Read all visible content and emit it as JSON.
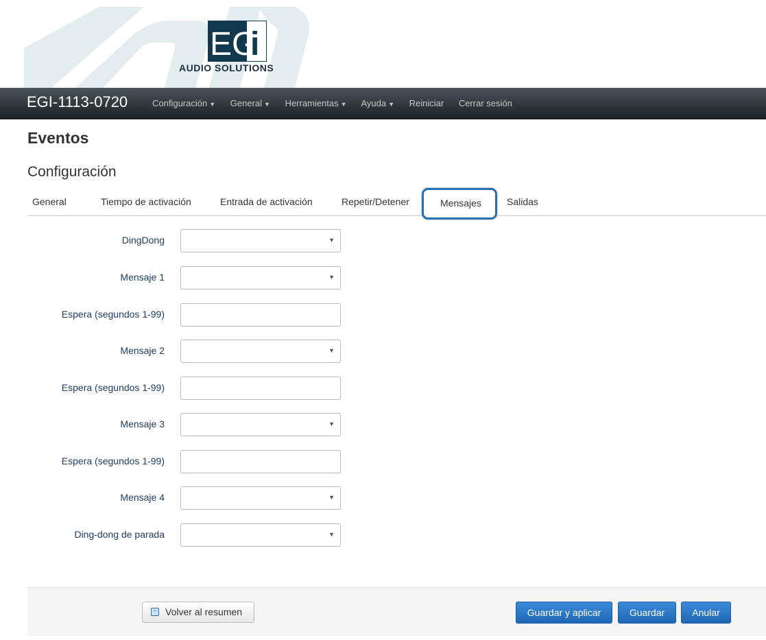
{
  "logo": {
    "letters_left": "EG",
    "letters_right": "i",
    "subtitle": "AUDIO SOLUTIONS"
  },
  "navbar": {
    "brand": "EGI-1113-0720",
    "items": [
      "Configuración",
      "General",
      "Herramientas",
      "Ayuda",
      "Reiniciar",
      "Cerrar sesión"
    ]
  },
  "page": {
    "title": "Eventos",
    "section": "Configuración"
  },
  "tabs": [
    "General",
    "Tiempo de activación",
    "Entrada de activación",
    "Repetir/Detener",
    "Mensajes",
    "Salidas"
  ],
  "active_tab": "Mensajes",
  "form": {
    "dingdong_label": "DingDong",
    "mensaje1_label": "Mensaje 1",
    "espera1_label": "Espera (segundos 1-99)",
    "mensaje2_label": "Mensaje 2",
    "espera2_label": "Espera (segundos 1-99)",
    "mensaje3_label": "Mensaje 3",
    "espera3_label": "Espera (segundos 1-99)",
    "mensaje4_label": "Mensaje 4",
    "stop_label": "Ding-dong de parada",
    "dingdong_value": "",
    "mensaje1_value": "",
    "espera1_value": "",
    "mensaje2_value": "",
    "espera2_value": "",
    "mensaje3_value": "",
    "espera3_value": "",
    "mensaje4_value": "",
    "stop_value": ""
  },
  "footer": {
    "back_label": "Volver al resumen",
    "save_apply_label": "Guardar y aplicar",
    "save_label": "Guardar",
    "cancel_label": "Anular"
  },
  "colors": {
    "accent": "#2b6fae",
    "primary_button": "#2a77c6",
    "navbar": "#2d3336"
  }
}
